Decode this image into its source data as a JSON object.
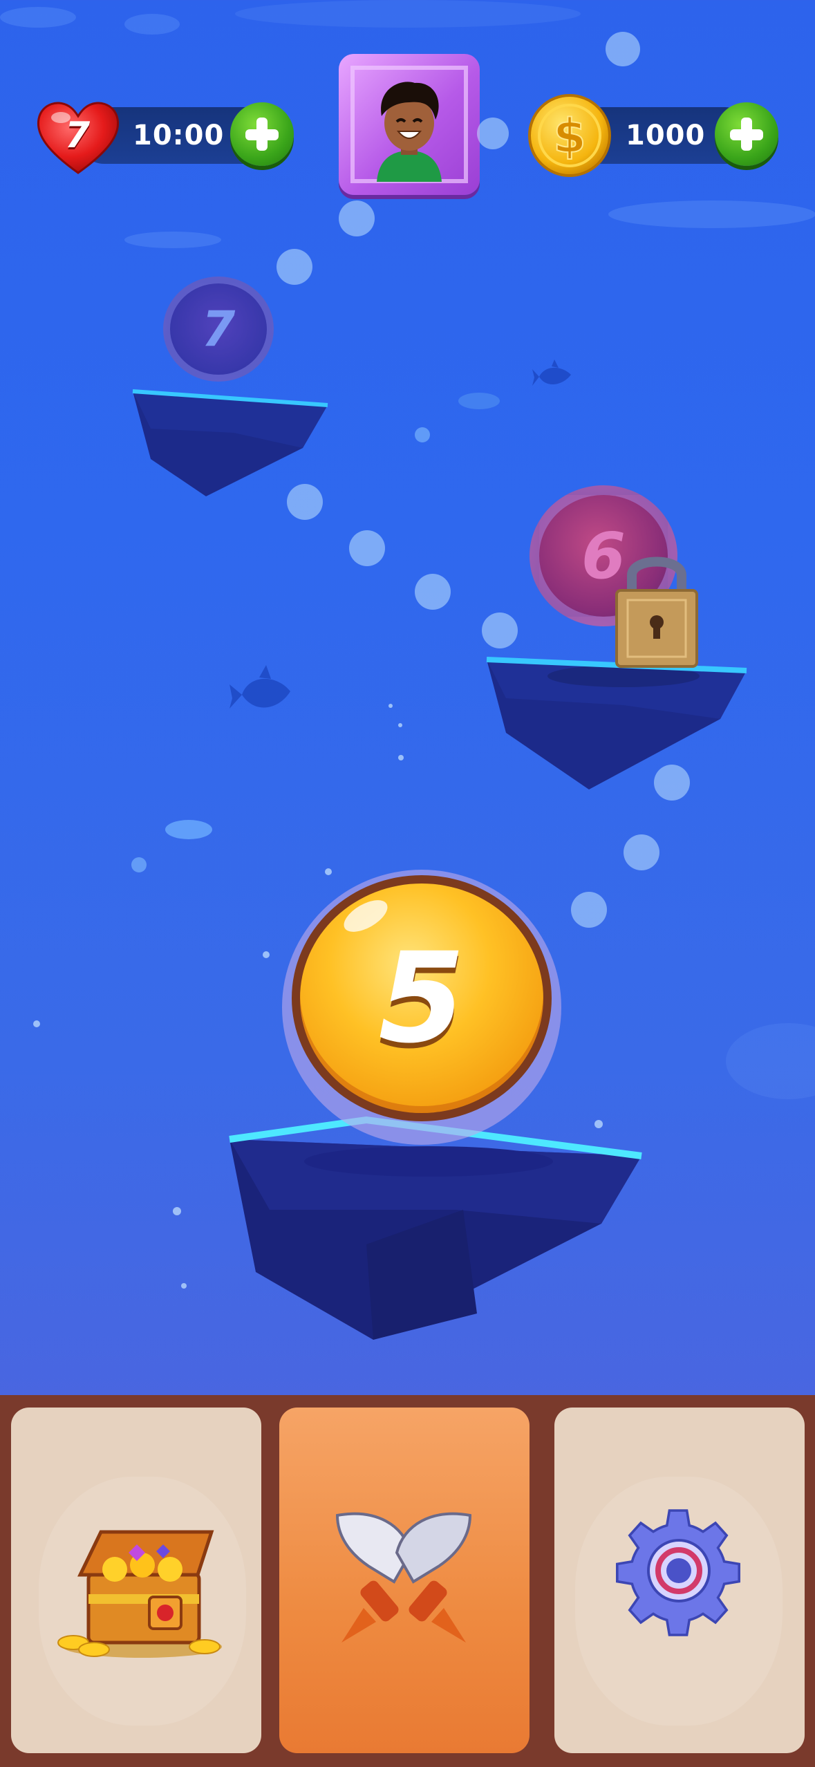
{
  "hud": {
    "lives": {
      "count": "7",
      "timer": "10:00",
      "icon": "heart-icon"
    },
    "avatar": {
      "icon": "player-avatar"
    },
    "coins": {
      "amount": "1000",
      "icon": "coin-icon"
    }
  },
  "map": {
    "levels": [
      {
        "number": "7",
        "state": "locked-faded"
      },
      {
        "number": "6",
        "state": "locked"
      },
      {
        "number": "5",
        "state": "current"
      }
    ]
  },
  "bottom_nav": {
    "tabs": [
      {
        "icon": "treasure-chest-icon",
        "state": "inactive"
      },
      {
        "icon": "crossed-swords-icon",
        "state": "active"
      },
      {
        "icon": "settings-gear-icon",
        "state": "inactive"
      }
    ]
  },
  "colors": {
    "background": "#2f68ee",
    "level_current": "#f7b21a",
    "level_locked": "#8a3f8f",
    "nav_frame": "#7a3a2c",
    "tab_active": "#ee8a40",
    "tab_inactive": "#e6d2bf"
  }
}
